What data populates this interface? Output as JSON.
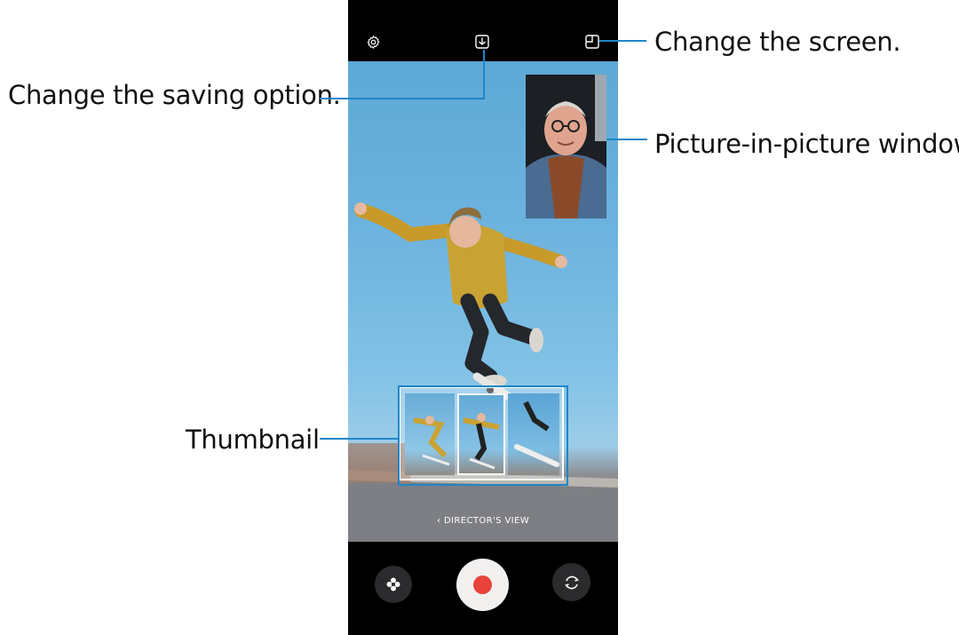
{
  "callouts": {
    "saving_option": "Change the saving option.",
    "change_screen": "Change the screen.",
    "pip_window": "Picture-in-picture window",
    "thumbnail": "Thumbnail"
  },
  "camera": {
    "mode_label": "DIRECTOR'S VIEW",
    "icons": {
      "settings": "gear-icon",
      "saving": "download-icon",
      "screen_layout": "layout-icon",
      "effects": "filter-icon",
      "record": "record-icon",
      "switch_camera": "switch-camera-icon"
    }
  },
  "colors": {
    "callout_line": "#1d86c7",
    "record_red": "#e8433b",
    "shutter_white": "#f2f0ef",
    "sky_blue": "#6cb3de"
  }
}
